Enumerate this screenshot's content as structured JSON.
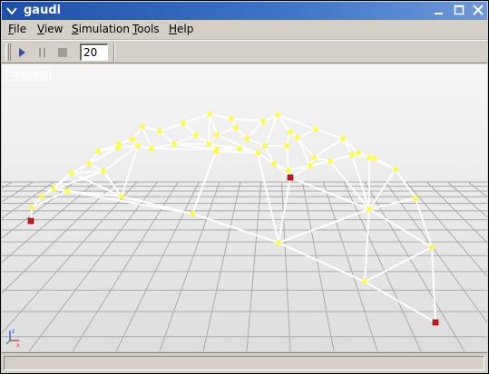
{
  "window": {
    "title": "gaudi",
    "buttons": {
      "minimize": "minimize-icon",
      "maximize": "maximize-icon",
      "close": "close-icon"
    }
  },
  "menubar": {
    "items": [
      {
        "label": "File",
        "accel": "F"
      },
      {
        "label": "View",
        "accel": "V"
      },
      {
        "label": "Simulation",
        "accel": "S"
      },
      {
        "label": "Tools",
        "accel": "T"
      },
      {
        "label": "Help",
        "accel": "H"
      }
    ]
  },
  "toolbar": {
    "play_icon": "play-icon",
    "pause_icon": "pause-icon",
    "stop_icon": "stop-icon",
    "steps_value": "20"
  },
  "viewport": {
    "options_label": "options",
    "colors": {
      "node": "#ffff33",
      "anchor": "#d01818",
      "strut": "#ffffff",
      "grid": "#a8a8a8"
    }
  },
  "statusbar": {
    "text": ""
  }
}
